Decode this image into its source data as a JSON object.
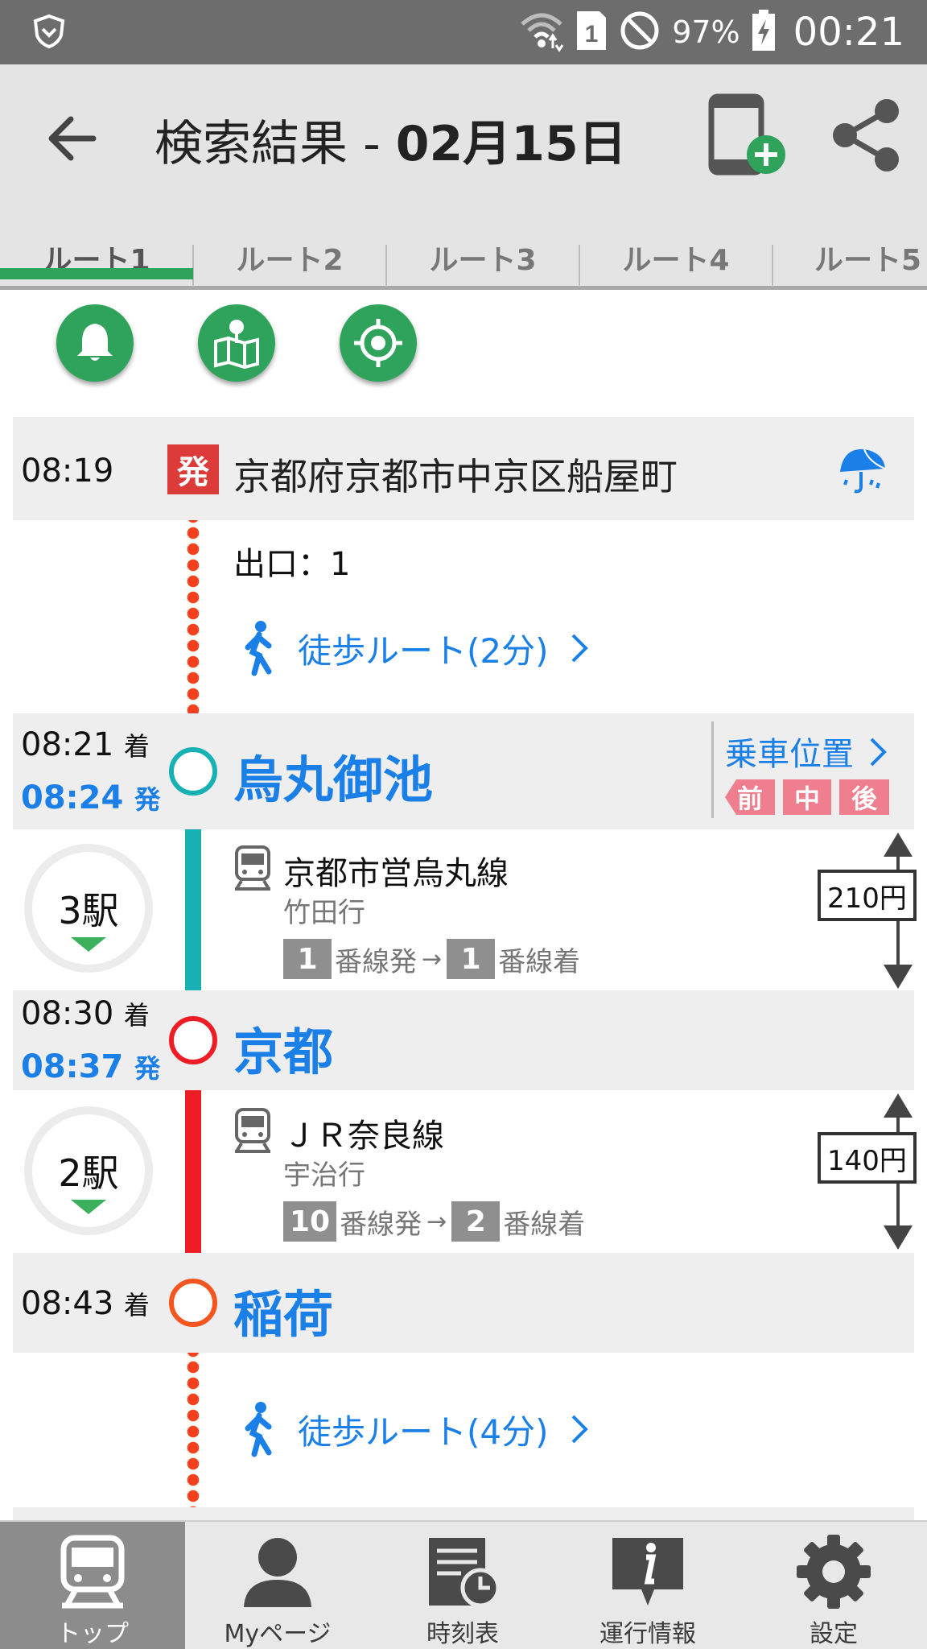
{
  "status_bar": {
    "battery": "97%",
    "time": "00:21",
    "sim": "1"
  },
  "header": {
    "title_prefix": "検索結果 - ",
    "title_date": "02月15日"
  },
  "tabs": [
    "ルート1",
    "ルート2",
    "ルート3",
    "ルート4",
    "ルート5"
  ],
  "route": {
    "depart_time": "08:19",
    "depart_badge": "発",
    "origin": "京都府京都市中京区船屋町",
    "exit": "出口：1",
    "walk1": "徒歩ルート(2分)",
    "stations": [
      {
        "name": "烏丸御池",
        "arr": "08:21",
        "dep": "08:24"
      },
      {
        "name": "京都",
        "arr": "08:30",
        "dep": "08:37"
      },
      {
        "name": "稲荷",
        "arr": "08:43"
      }
    ],
    "arr_suffix": "着",
    "dep_suffix": "発",
    "boarding": {
      "label": "乗車位置",
      "cars": [
        "前",
        "中",
        "後"
      ]
    },
    "legs": [
      {
        "count": "3駅",
        "line": "京都市営烏丸線",
        "dest": "竹田行",
        "from_track": "1",
        "from_label": "番線発",
        "to_track": "1",
        "to_label": "番線着",
        "fare": "210円"
      },
      {
        "count": "2駅",
        "line": "ＪＲ奈良線",
        "dest": "宇治行",
        "from_track": "10",
        "from_label": "番線発",
        "to_track": "2",
        "to_label": "番線着",
        "fare": "140円"
      }
    ],
    "walk2": "徒歩ルート(4分)"
  },
  "bottom_nav": [
    "トップ",
    "Myページ",
    "時刻表",
    "運行情報",
    "設定"
  ],
  "colors": {
    "accent_green": "#2fa35b",
    "link_blue": "#1a7fe6",
    "karasuma_line": "#17b1b4",
    "jr_line": "#ee1c25",
    "walk_dots": "#f5401d"
  }
}
